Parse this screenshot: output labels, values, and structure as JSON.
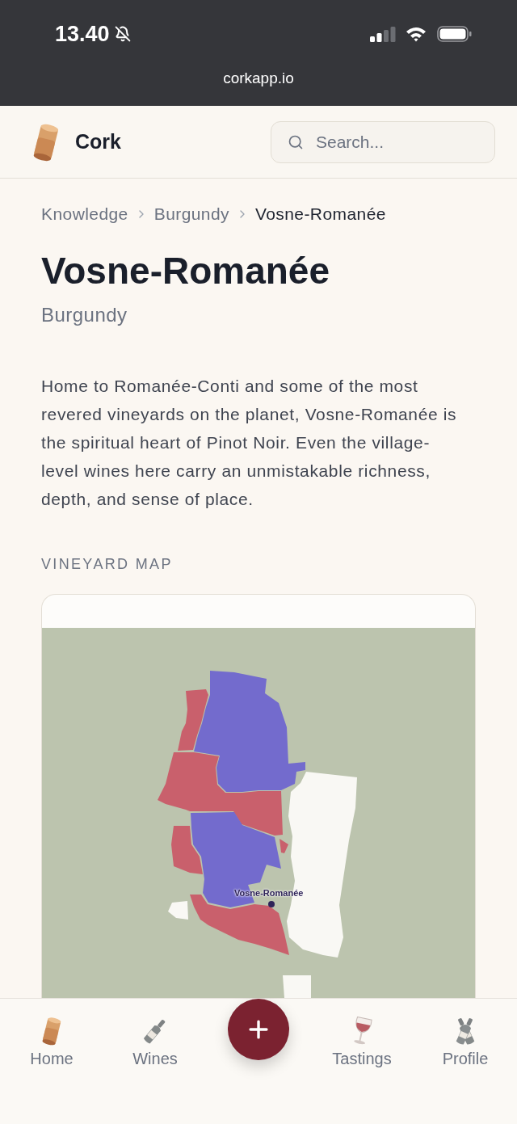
{
  "status_bar": {
    "time": "13.40",
    "url": "corkapp.io"
  },
  "header": {
    "brand": "Cork",
    "search": {
      "placeholder": "Search..."
    }
  },
  "breadcrumb": [
    {
      "label": "Knowledge",
      "current": false
    },
    {
      "label": "Burgundy",
      "current": false
    },
    {
      "label": "Vosne-Romanée",
      "current": true
    }
  ],
  "title": "Vosne-Romanée",
  "subtitle": "Burgundy",
  "description": "Home to Romanée-Conti and some of the most revered vineyards on the planet, Vosne-Romanée is the spiritual heart of Pinot Noir. Even the village-level wines here carry an unmistakable richness, depth, and sense of place.",
  "vineyard_map": {
    "heading": "VINEYARD MAP",
    "marker": {
      "label": "Vosne-Romanée"
    }
  },
  "bottom_nav": [
    {
      "kind": "link",
      "label": "Home"
    },
    {
      "kind": "link",
      "label": "Wines"
    },
    {
      "kind": "add"
    },
    {
      "kind": "link",
      "label": "Tastings"
    },
    {
      "kind": "link",
      "label": "Profile"
    }
  ]
}
